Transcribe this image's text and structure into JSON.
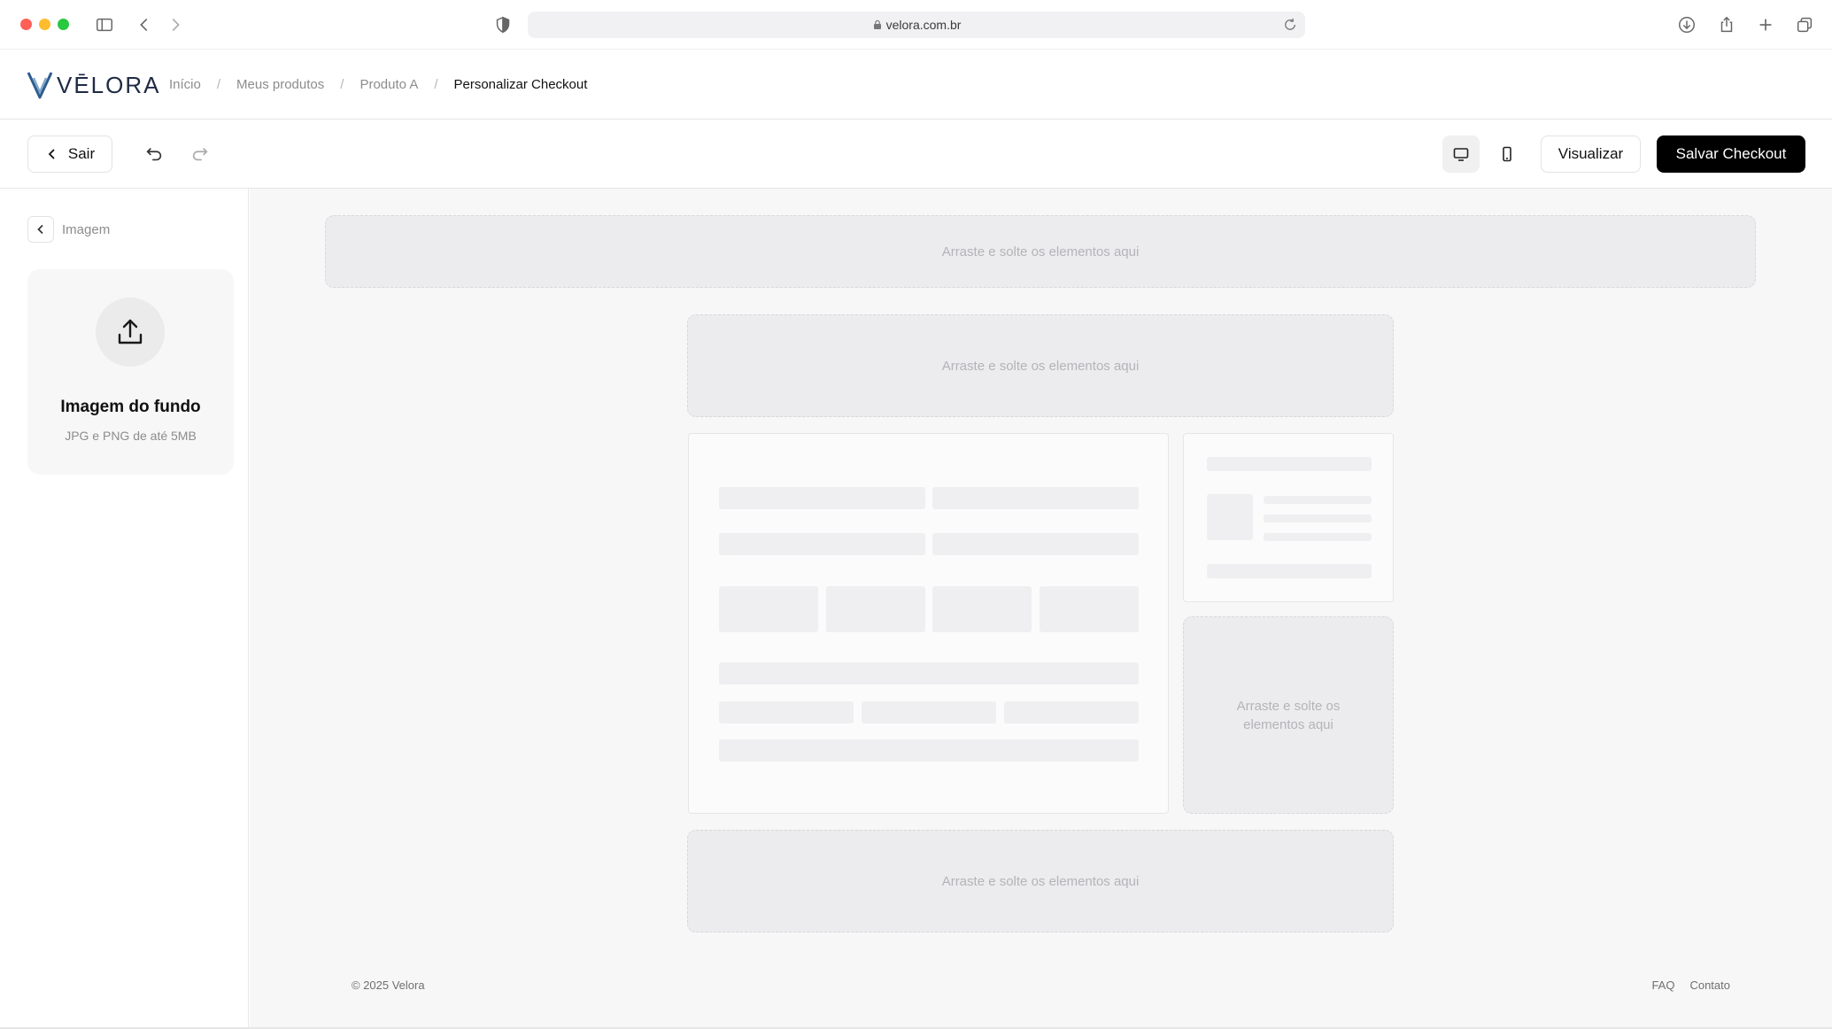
{
  "browser": {
    "url": "velora.com.br",
    "icons": [
      "sidebar-toggle-icon",
      "back-icon",
      "forward-icon",
      "shield-icon",
      "lock-icon",
      "reload-icon",
      "download-icon",
      "share-icon",
      "new-tab-icon",
      "tabs-overview-icon"
    ]
  },
  "header": {
    "logo_text": "VĒLORA",
    "breadcrumb": [
      "Início",
      "Meus produtos",
      "Produto A",
      "Personalizar Checkout"
    ]
  },
  "toolbar": {
    "exit_label": "Sair",
    "preview_label": "Visualizar",
    "save_label": "Salvar Checkout",
    "device_modes": [
      "desktop",
      "mobile"
    ],
    "active_device": "desktop"
  },
  "sidebar": {
    "back_label": "Imagem",
    "upload": {
      "title": "Imagem do fundo",
      "subtitle": "JPG e PNG de até 5MB"
    }
  },
  "canvas": {
    "dropzone_text": "Arraste e solte os elementos aqui",
    "dropzone_text_narrow": "Arraste e solte os elementos aqui"
  },
  "footer": {
    "copyright": "© 2025 Velora",
    "links": [
      "FAQ",
      "Contato"
    ]
  },
  "colors": {
    "primary_button": "#000000",
    "canvas_background": "#f7f7f8",
    "dropzone_background": "#ececee"
  }
}
